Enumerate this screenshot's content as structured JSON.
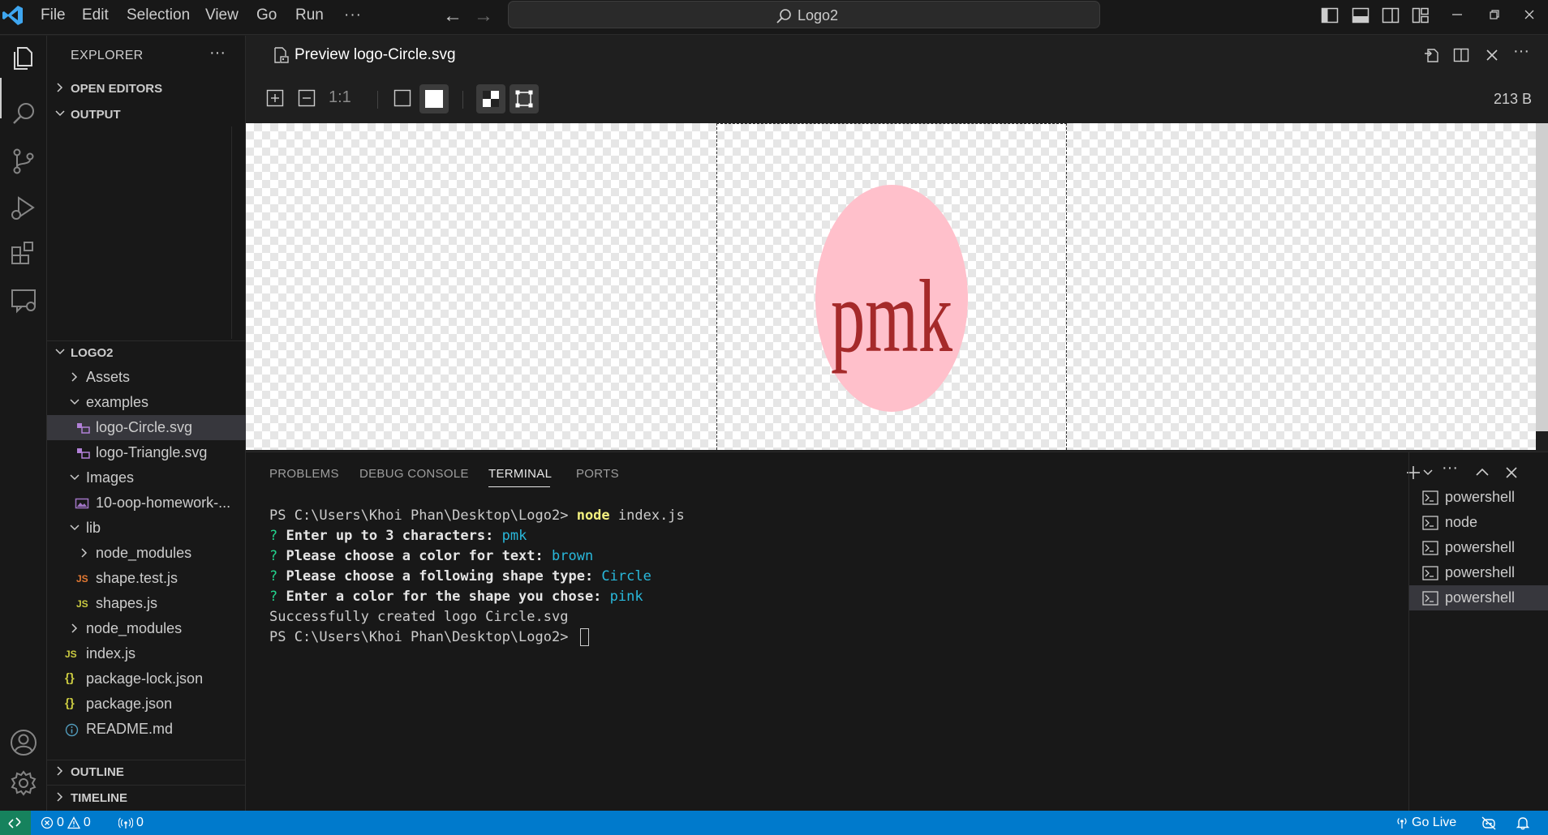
{
  "titlebar": {
    "menus": [
      "File",
      "Edit",
      "Selection",
      "View",
      "Go",
      "Run",
      "···"
    ],
    "search_text": "Logo2"
  },
  "sidebar": {
    "title": "EXPLORER",
    "more": "···",
    "open_editors": "OPEN EDITORS",
    "output": "OUTPUT",
    "project": "LOGO2",
    "tree": [
      {
        "label": "Assets",
        "type": "folder",
        "expanded": false
      },
      {
        "label": "examples",
        "type": "folder",
        "expanded": true
      },
      {
        "label": "logo-Circle.svg",
        "type": "svg"
      },
      {
        "label": "logo-Triangle.svg",
        "type": "svg"
      },
      {
        "label": "Images",
        "type": "folder",
        "expanded": true
      },
      {
        "label": "10-oop-homework-...",
        "type": "image"
      },
      {
        "label": "lib",
        "type": "folder",
        "expanded": true
      },
      {
        "label": "node_modules",
        "type": "folder",
        "expanded": false
      },
      {
        "label": "shape.test.js",
        "type": "js-test"
      },
      {
        "label": "shapes.js",
        "type": "js"
      },
      {
        "label": "node_modules",
        "type": "folder",
        "expanded": false
      },
      {
        "label": "index.js",
        "type": "js"
      },
      {
        "label": "package-lock.json",
        "type": "json"
      },
      {
        "label": "package.json",
        "type": "json"
      },
      {
        "label": "README.md",
        "type": "info"
      }
    ],
    "outline": "OUTLINE",
    "timeline": "TIMELINE"
  },
  "editor": {
    "tab_title": "Preview logo-Circle.svg",
    "zoom_reset": "1:1",
    "file_size": "213 B",
    "logo_text": "pmk",
    "logo_text_color": "#a52a2a",
    "logo_shape_color": "#ffc0cb"
  },
  "panel": {
    "tabs": [
      "PROBLEMS",
      "DEBUG CONSOLE",
      "TERMINAL",
      "PORTS"
    ],
    "terminal": {
      "line1_prompt": "PS C:\\Users\\Khoi Phan\\Desktop\\Logo2> ",
      "line1_cmd": "node",
      "line1_arg": " index.js",
      "q1": "Enter up to 3 characters: ",
      "a1": "pmk",
      "q2": "Please choose a color for text: ",
      "a2": "brown",
      "q3": "Please choose a following shape type: ",
      "a3": "Circle",
      "q4": "Enter a color for the shape you chose: ",
      "a4": "pink",
      "success": "Successfully created logo Circle.svg",
      "prompt2": "PS C:\\Users\\Khoi Phan\\Desktop\\Logo2> "
    },
    "terminals": [
      "powershell",
      "node",
      "powershell",
      "powershell",
      "powershell"
    ]
  },
  "statusbar": {
    "errors": "0",
    "warnings": "0",
    "ports": "0",
    "go_live": "Go Live"
  }
}
